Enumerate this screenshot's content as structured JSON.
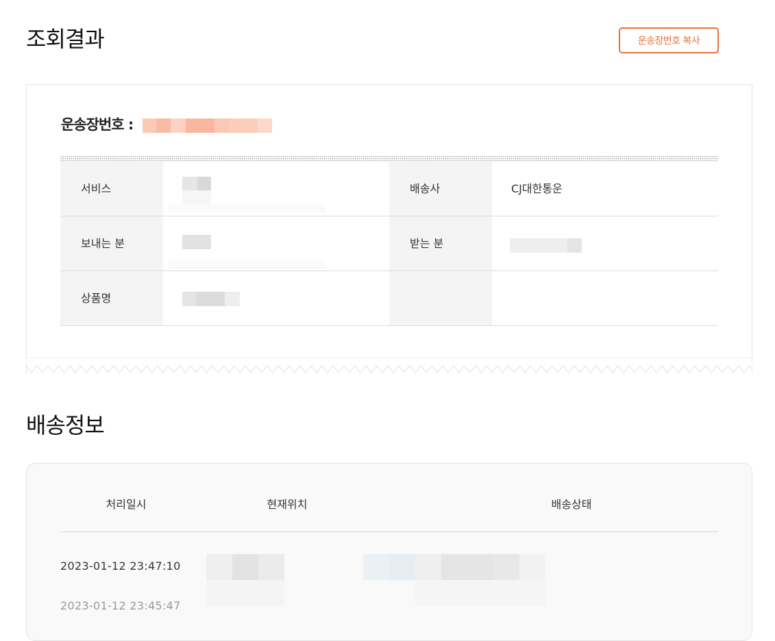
{
  "header": {
    "title": "조회결과",
    "copy_button": "운송장번호 복사"
  },
  "result": {
    "waybill_label": "운송장번호 :",
    "rows": [
      {
        "left_label": "서비스",
        "left_value": "",
        "right_label": "배송사",
        "right_value": "CJ대한통운"
      },
      {
        "left_label": "보내는 분",
        "left_value": "",
        "right_label": "받는 분",
        "right_value": ""
      },
      {
        "left_label": "상품명",
        "left_value": "",
        "right_label": "",
        "right_value": ""
      }
    ]
  },
  "delivery": {
    "title": "배송정보",
    "columns": [
      "처리일시",
      "현재위치",
      "배송상태"
    ],
    "entries": [
      {
        "date": "2023-01-12 23:47:10"
      },
      {
        "date": "2023-01-12 23:45:47"
      }
    ]
  },
  "colors": {
    "accent": "#e8713a",
    "label_bg": "#f4f4f4",
    "card_bg": "#f9f9f9"
  }
}
